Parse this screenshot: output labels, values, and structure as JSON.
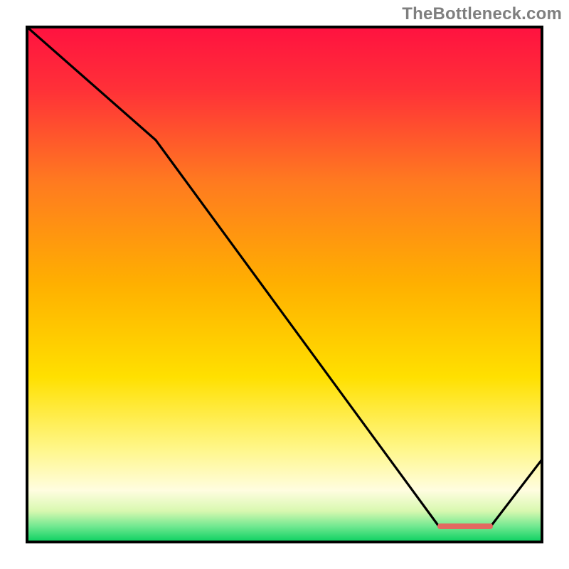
{
  "watermark": "TheBottleneck.com",
  "chart_data": {
    "type": "line",
    "title": "",
    "xlabel": "",
    "ylabel": "",
    "xlim": [
      0,
      100
    ],
    "ylim": [
      0,
      100
    ],
    "grid": false,
    "legend": false,
    "series": [
      {
        "name": "bottleneck-curve",
        "x": [
          0,
          25,
          80,
          90,
          100
        ],
        "y": [
          100,
          78,
          3,
          3,
          16
        ]
      }
    ],
    "marker": {
      "name": "highlight-segment",
      "x_start": 80,
      "x_end": 90,
      "y": 3,
      "color": "#e36a61"
    },
    "background_gradient": {
      "top_color": "#ff1240",
      "mid_color": "#ffd400",
      "low_color": "#fffcc0",
      "bottom_color": "#0ad060"
    },
    "frame_color": "#000000"
  }
}
